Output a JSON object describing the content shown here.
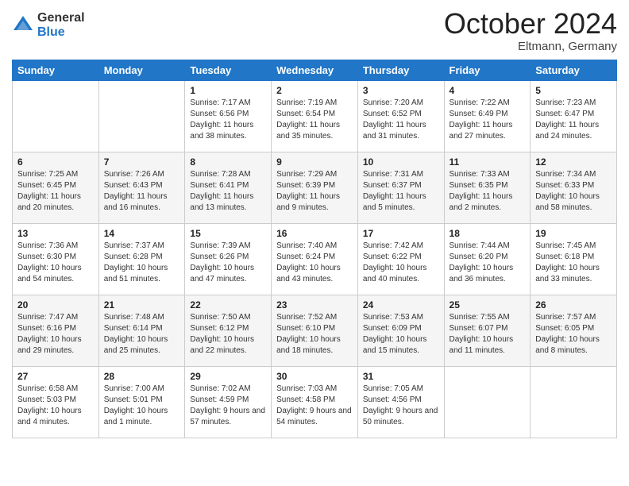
{
  "logo": {
    "general": "General",
    "blue": "Blue"
  },
  "header": {
    "month": "October 2024",
    "location": "Eltmann, Germany"
  },
  "days_of_week": [
    "Sunday",
    "Monday",
    "Tuesday",
    "Wednesday",
    "Thursday",
    "Friday",
    "Saturday"
  ],
  "weeks": [
    [
      {
        "day": "",
        "sunrise": "",
        "sunset": "",
        "daylight": ""
      },
      {
        "day": "",
        "sunrise": "",
        "sunset": "",
        "daylight": ""
      },
      {
        "day": "1",
        "sunrise": "Sunrise: 7:17 AM",
        "sunset": "Sunset: 6:56 PM",
        "daylight": "Daylight: 11 hours and 38 minutes."
      },
      {
        "day": "2",
        "sunrise": "Sunrise: 7:19 AM",
        "sunset": "Sunset: 6:54 PM",
        "daylight": "Daylight: 11 hours and 35 minutes."
      },
      {
        "day": "3",
        "sunrise": "Sunrise: 7:20 AM",
        "sunset": "Sunset: 6:52 PM",
        "daylight": "Daylight: 11 hours and 31 minutes."
      },
      {
        "day": "4",
        "sunrise": "Sunrise: 7:22 AM",
        "sunset": "Sunset: 6:49 PM",
        "daylight": "Daylight: 11 hours and 27 minutes."
      },
      {
        "day": "5",
        "sunrise": "Sunrise: 7:23 AM",
        "sunset": "Sunset: 6:47 PM",
        "daylight": "Daylight: 11 hours and 24 minutes."
      }
    ],
    [
      {
        "day": "6",
        "sunrise": "Sunrise: 7:25 AM",
        "sunset": "Sunset: 6:45 PM",
        "daylight": "Daylight: 11 hours and 20 minutes."
      },
      {
        "day": "7",
        "sunrise": "Sunrise: 7:26 AM",
        "sunset": "Sunset: 6:43 PM",
        "daylight": "Daylight: 11 hours and 16 minutes."
      },
      {
        "day": "8",
        "sunrise": "Sunrise: 7:28 AM",
        "sunset": "Sunset: 6:41 PM",
        "daylight": "Daylight: 11 hours and 13 minutes."
      },
      {
        "day": "9",
        "sunrise": "Sunrise: 7:29 AM",
        "sunset": "Sunset: 6:39 PM",
        "daylight": "Daylight: 11 hours and 9 minutes."
      },
      {
        "day": "10",
        "sunrise": "Sunrise: 7:31 AM",
        "sunset": "Sunset: 6:37 PM",
        "daylight": "Daylight: 11 hours and 5 minutes."
      },
      {
        "day": "11",
        "sunrise": "Sunrise: 7:33 AM",
        "sunset": "Sunset: 6:35 PM",
        "daylight": "Daylight: 11 hours and 2 minutes."
      },
      {
        "day": "12",
        "sunrise": "Sunrise: 7:34 AM",
        "sunset": "Sunset: 6:33 PM",
        "daylight": "Daylight: 10 hours and 58 minutes."
      }
    ],
    [
      {
        "day": "13",
        "sunrise": "Sunrise: 7:36 AM",
        "sunset": "Sunset: 6:30 PM",
        "daylight": "Daylight: 10 hours and 54 minutes."
      },
      {
        "day": "14",
        "sunrise": "Sunrise: 7:37 AM",
        "sunset": "Sunset: 6:28 PM",
        "daylight": "Daylight: 10 hours and 51 minutes."
      },
      {
        "day": "15",
        "sunrise": "Sunrise: 7:39 AM",
        "sunset": "Sunset: 6:26 PM",
        "daylight": "Daylight: 10 hours and 47 minutes."
      },
      {
        "day": "16",
        "sunrise": "Sunrise: 7:40 AM",
        "sunset": "Sunset: 6:24 PM",
        "daylight": "Daylight: 10 hours and 43 minutes."
      },
      {
        "day": "17",
        "sunrise": "Sunrise: 7:42 AM",
        "sunset": "Sunset: 6:22 PM",
        "daylight": "Daylight: 10 hours and 40 minutes."
      },
      {
        "day": "18",
        "sunrise": "Sunrise: 7:44 AM",
        "sunset": "Sunset: 6:20 PM",
        "daylight": "Daylight: 10 hours and 36 minutes."
      },
      {
        "day": "19",
        "sunrise": "Sunrise: 7:45 AM",
        "sunset": "Sunset: 6:18 PM",
        "daylight": "Daylight: 10 hours and 33 minutes."
      }
    ],
    [
      {
        "day": "20",
        "sunrise": "Sunrise: 7:47 AM",
        "sunset": "Sunset: 6:16 PM",
        "daylight": "Daylight: 10 hours and 29 minutes."
      },
      {
        "day": "21",
        "sunrise": "Sunrise: 7:48 AM",
        "sunset": "Sunset: 6:14 PM",
        "daylight": "Daylight: 10 hours and 25 minutes."
      },
      {
        "day": "22",
        "sunrise": "Sunrise: 7:50 AM",
        "sunset": "Sunset: 6:12 PM",
        "daylight": "Daylight: 10 hours and 22 minutes."
      },
      {
        "day": "23",
        "sunrise": "Sunrise: 7:52 AM",
        "sunset": "Sunset: 6:10 PM",
        "daylight": "Daylight: 10 hours and 18 minutes."
      },
      {
        "day": "24",
        "sunrise": "Sunrise: 7:53 AM",
        "sunset": "Sunset: 6:09 PM",
        "daylight": "Daylight: 10 hours and 15 minutes."
      },
      {
        "day": "25",
        "sunrise": "Sunrise: 7:55 AM",
        "sunset": "Sunset: 6:07 PM",
        "daylight": "Daylight: 10 hours and 11 minutes."
      },
      {
        "day": "26",
        "sunrise": "Sunrise: 7:57 AM",
        "sunset": "Sunset: 6:05 PM",
        "daylight": "Daylight: 10 hours and 8 minutes."
      }
    ],
    [
      {
        "day": "27",
        "sunrise": "Sunrise: 6:58 AM",
        "sunset": "Sunset: 5:03 PM",
        "daylight": "Daylight: 10 hours and 4 minutes."
      },
      {
        "day": "28",
        "sunrise": "Sunrise: 7:00 AM",
        "sunset": "Sunset: 5:01 PM",
        "daylight": "Daylight: 10 hours and 1 minute."
      },
      {
        "day": "29",
        "sunrise": "Sunrise: 7:02 AM",
        "sunset": "Sunset: 4:59 PM",
        "daylight": "Daylight: 9 hours and 57 minutes."
      },
      {
        "day": "30",
        "sunrise": "Sunrise: 7:03 AM",
        "sunset": "Sunset: 4:58 PM",
        "daylight": "Daylight: 9 hours and 54 minutes."
      },
      {
        "day": "31",
        "sunrise": "Sunrise: 7:05 AM",
        "sunset": "Sunset: 4:56 PM",
        "daylight": "Daylight: 9 hours and 50 minutes."
      },
      {
        "day": "",
        "sunrise": "",
        "sunset": "",
        "daylight": ""
      },
      {
        "day": "",
        "sunrise": "",
        "sunset": "",
        "daylight": ""
      }
    ]
  ]
}
